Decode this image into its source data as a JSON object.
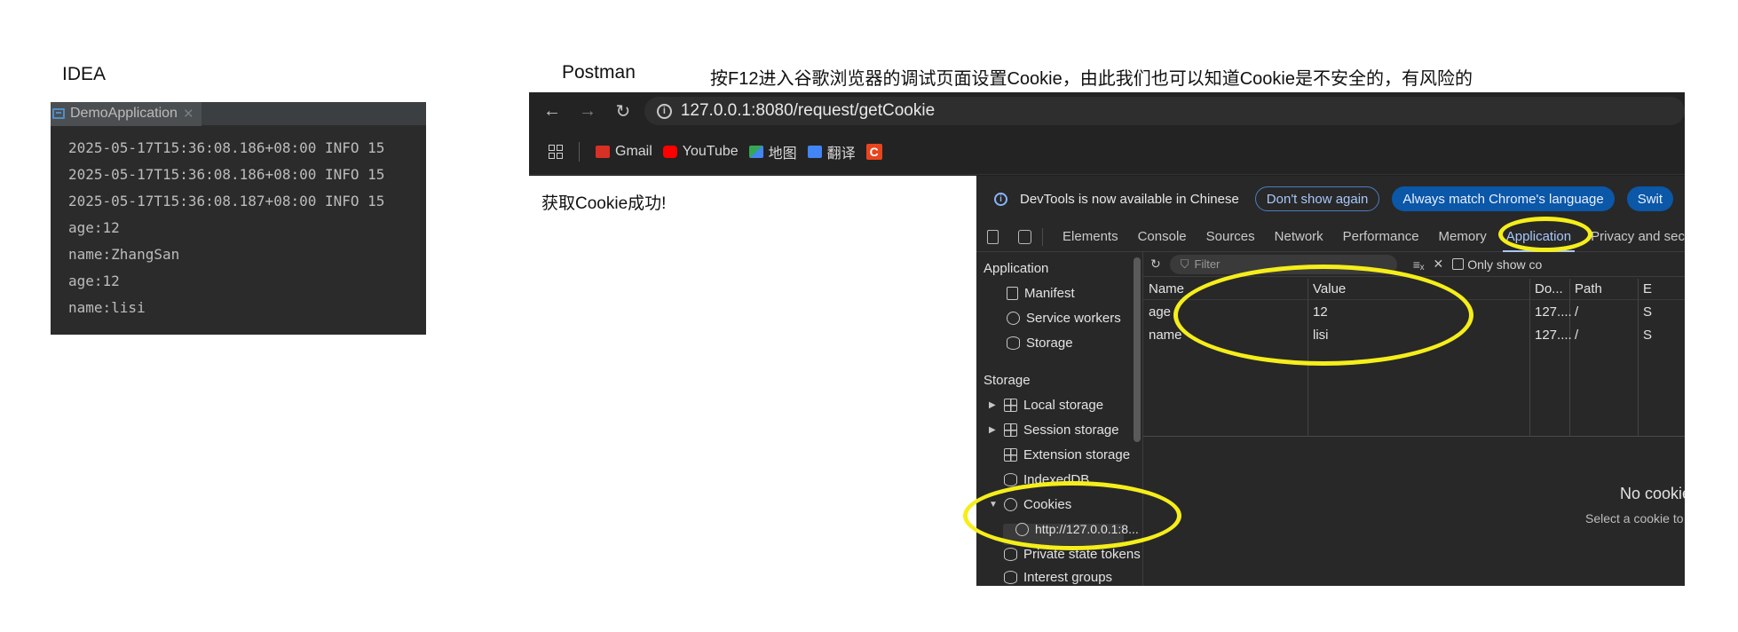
{
  "captions": {
    "idea": "IDEA",
    "postman": "Postman",
    "note": "按F12进入谷歌浏览器的调试页面设置Cookie，由此我们也可以知道Cookie是不安全的，有风险的"
  },
  "idea": {
    "tab_label": "DemoApplication",
    "log_lines": [
      "2025-05-17T15:36:08.186+08:00  INFO 15",
      "2025-05-17T15:36:08.186+08:00  INFO 15",
      "2025-05-17T15:36:08.187+08:00  INFO 15",
      "age:12",
      "name:ZhangSan",
      "age:12",
      "name:lisi"
    ]
  },
  "browser": {
    "url": "127.0.0.1:8080/request/getCookie",
    "bookmarks": [
      {
        "label": "Gmail",
        "icon": "gmail-icon",
        "color": "#d93025"
      },
      {
        "label": "YouTube",
        "icon": "youtube-icon",
        "color": "#ff0000"
      },
      {
        "label": "地图",
        "icon": "maps-icon",
        "color": "#34a853"
      },
      {
        "label": "翻译",
        "icon": "translate-icon",
        "color": "#4285f4"
      },
      {
        "label": "",
        "icon": "c-app-icon",
        "color": "#e8451e"
      }
    ],
    "page_text": "获取Cookie成功!"
  },
  "devtools": {
    "banner_text": "DevTools is now available in Chinese",
    "dont_show": "Don't show again",
    "always_match": "Always match Chrome's language",
    "switch_partial": "Swit",
    "tabs": [
      "Elements",
      "Console",
      "Sources",
      "Network",
      "Performance",
      "Memory",
      "Application",
      "Privacy and sec"
    ],
    "active_tab": "Application",
    "sidebar": {
      "application_header": "Application",
      "application_items": [
        "Manifest",
        "Service workers",
        "Storage"
      ],
      "storage_header": "Storage",
      "storage_items": [
        "Local storage",
        "Session storage",
        "Extension storage",
        "IndexedDB",
        "Cookies"
      ],
      "cookie_origin": "http://127.0.0.1:8...",
      "more_items": [
        "Private state tokens",
        "Interest groups"
      ]
    },
    "filter_placeholder": "Filter",
    "only_show": "Only show co",
    "table": {
      "headers": [
        "Name",
        "Value",
        "Do...",
        "Path",
        "E"
      ],
      "rows": [
        {
          "name": "age",
          "value": "12",
          "domain": "127....",
          "path": "/",
          "e": "S"
        },
        {
          "name": "name",
          "value": "lisi",
          "domain": "127....",
          "path": "/",
          "e": "S"
        }
      ]
    },
    "no_cookie": "No cookie selected",
    "no_cookie_sub": "Select a cookie to preview its"
  },
  "colors": {
    "highlight": "#f5ee1a",
    "devtools_bg": "#282828",
    "accent_blue": "#a8c7fa"
  }
}
